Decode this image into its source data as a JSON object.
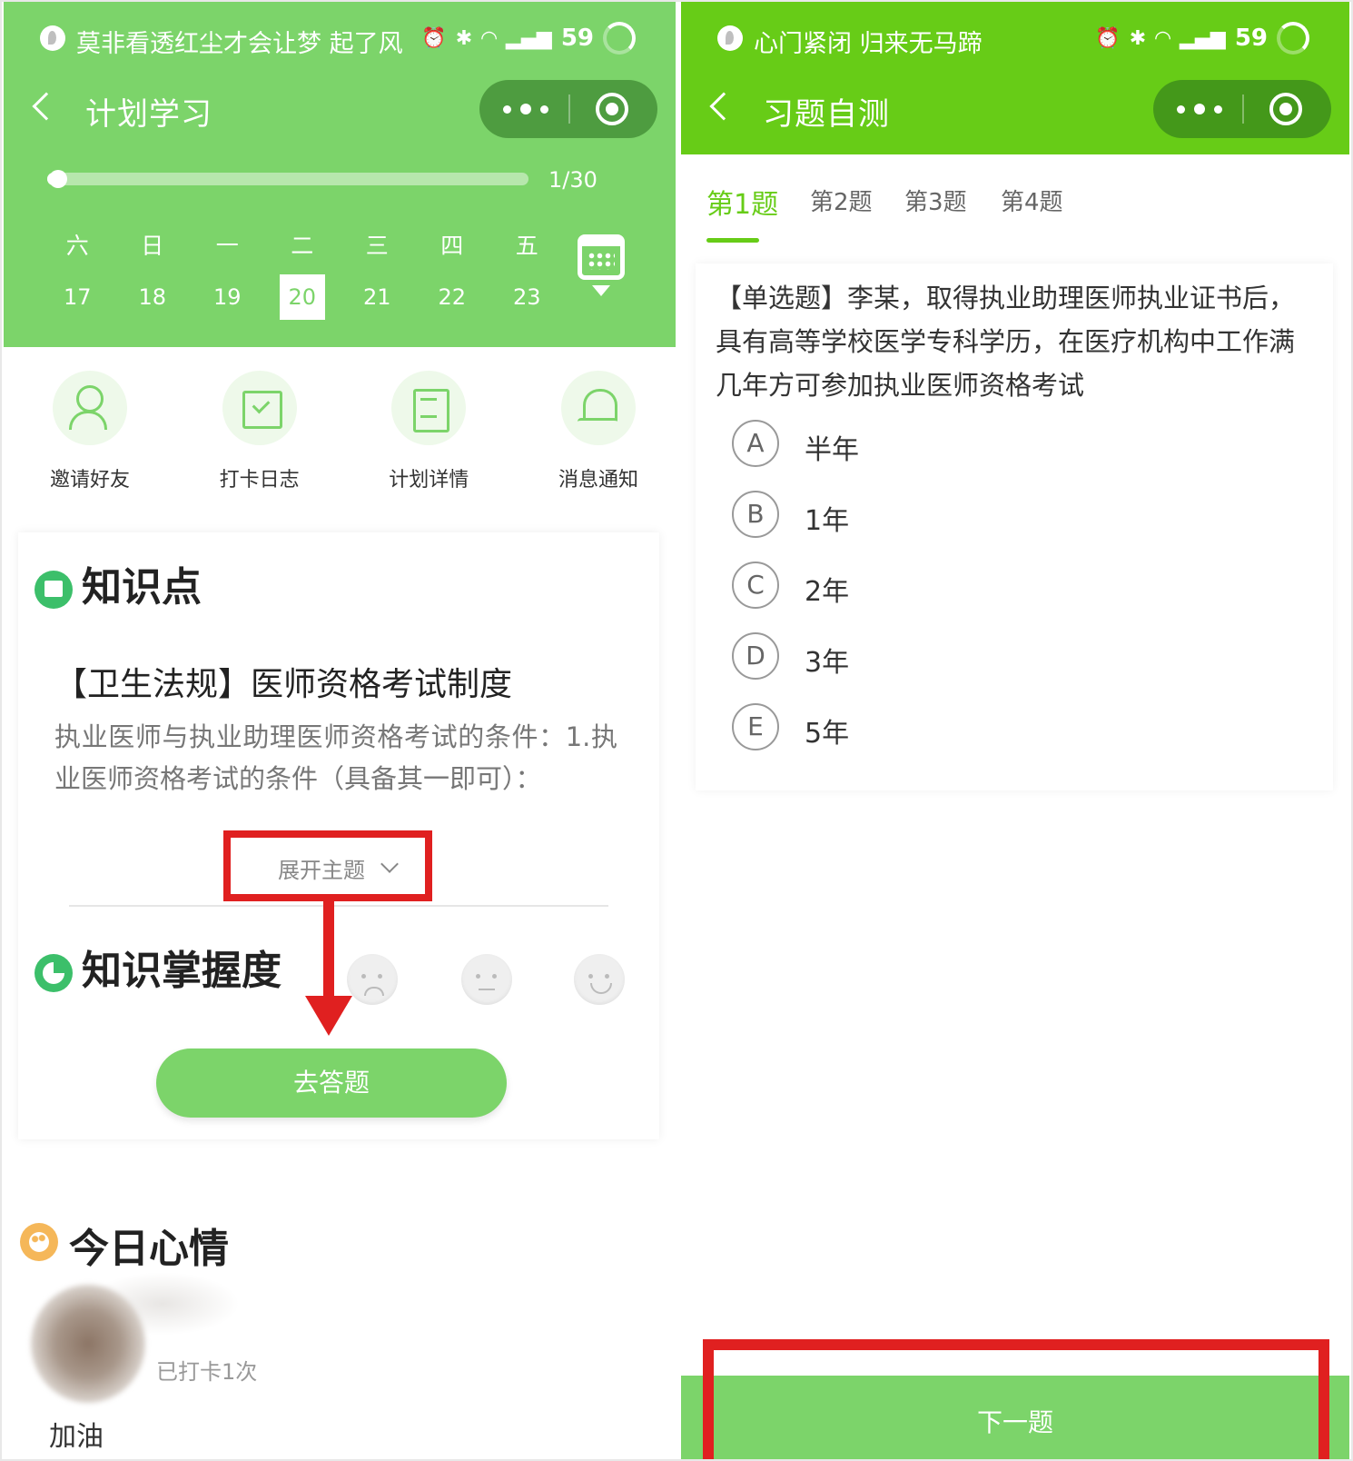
{
  "left": {
    "status_bar": {
      "music_note": "莫非看透红尘才会让梦 起了风",
      "battery": "59",
      "network": "4G"
    },
    "nav": {
      "title": "计划学习"
    },
    "progress": {
      "text": "1/30",
      "value": 0.033
    },
    "week": [
      {
        "weekday": "六",
        "date": "17"
      },
      {
        "weekday": "日",
        "date": "18"
      },
      {
        "weekday": "一",
        "date": "19"
      },
      {
        "weekday": "二",
        "date": "20",
        "selected": true
      },
      {
        "weekday": "三",
        "date": "21"
      },
      {
        "weekday": "四",
        "date": "22"
      },
      {
        "weekday": "五",
        "date": "23"
      }
    ],
    "quick_actions": [
      {
        "label": "邀请好友",
        "icon": "add-friend-icon"
      },
      {
        "label": "打卡日志",
        "icon": "calendar-check-icon"
      },
      {
        "label": "计划详情",
        "icon": "document-icon"
      },
      {
        "label": "消息通知",
        "icon": "bell-icon"
      }
    ],
    "knowledge": {
      "section_title": "知识点",
      "heading": "【卫生法规】医师资格考试制度",
      "body": "执业医师与执业助理医师资格考试的条件：1.执业医师资格考试的条件（具备其一即可）：",
      "expand_label": "展开主题"
    },
    "mastery": {
      "section_title": "知识掌握度",
      "faces": [
        "sad-face-icon",
        "neutral-face-icon",
        "happy-face-icon"
      ]
    },
    "answer_button": "去答题",
    "mood": {
      "section_title": "今日心情",
      "checkins": "已打卡1次",
      "message": "加油"
    }
  },
  "right": {
    "status_bar": {
      "music_note": "心门紧闭 归来无马蹄",
      "battery": "59",
      "network": "4G"
    },
    "nav": {
      "title": "习题自测"
    },
    "tabs": [
      "第1题",
      "第2题",
      "第3题",
      "第4题"
    ],
    "active_tab": 0,
    "question": "【单选题】李某，取得执业助理医师执业证书后，具有高等学校医学专科学历，在医疗机构中工作满几年方可参加执业医师资格考试",
    "options": [
      {
        "key": "A",
        "text": "半年"
      },
      {
        "key": "B",
        "text": "1年"
      },
      {
        "key": "C",
        "text": "2年"
      },
      {
        "key": "D",
        "text": "3年"
      },
      {
        "key": "E",
        "text": "5年"
      }
    ],
    "next_button": "下一题"
  },
  "colors": {
    "left_theme": "#7cd46a",
    "right_theme": "#67cc17",
    "highlight_red": "#e02020"
  }
}
